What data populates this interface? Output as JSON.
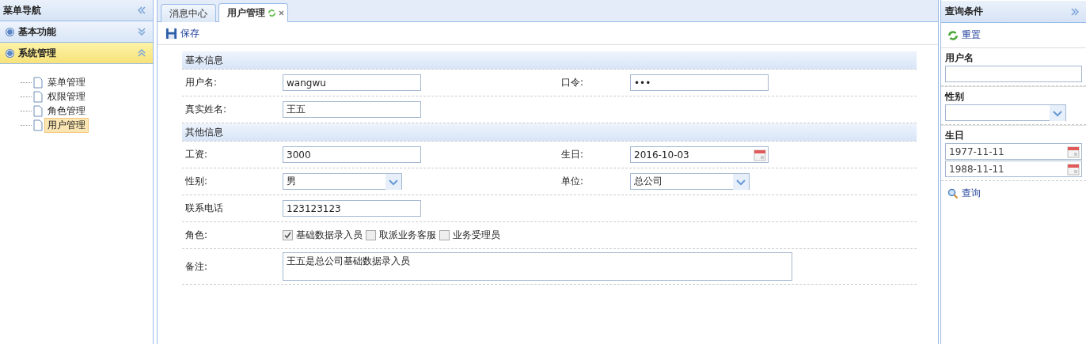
{
  "sidebar": {
    "title": "菜单导航",
    "groups": [
      {
        "label": "基本功能",
        "expanded": false
      },
      {
        "label": "系统管理",
        "expanded": true,
        "items": [
          {
            "label": "菜单管理",
            "selected": false
          },
          {
            "label": "权限管理",
            "selected": false
          },
          {
            "label": "角色管理",
            "selected": false
          },
          {
            "label": "用户管理",
            "selected": true
          }
        ]
      }
    ]
  },
  "tabs": [
    {
      "label": "消息中心",
      "selected": false,
      "closable": false
    },
    {
      "label": "用户管理",
      "selected": true,
      "closable": true
    }
  ],
  "toolbar": {
    "save": "保存"
  },
  "form": {
    "sections": [
      {
        "title": "基本信息",
        "rows": [
          [
            {
              "label": "用户名:",
              "kind": "text",
              "value": "wangwu"
            },
            {
              "label": "口令:",
              "kind": "password",
              "value": "•••"
            }
          ],
          [
            {
              "label": "真实姓名:",
              "kind": "text",
              "value": "王五"
            }
          ]
        ]
      },
      {
        "title": "其他信息",
        "rows": [
          [
            {
              "label": "工资:",
              "kind": "text",
              "value": "3000"
            },
            {
              "label": "生日:",
              "kind": "date",
              "value": "2016-10-03"
            }
          ],
          [
            {
              "label": "性别:",
              "kind": "select",
              "value": "男"
            },
            {
              "label": "单位:",
              "kind": "select",
              "value": "总公司"
            }
          ],
          [
            {
              "label": "联系电话",
              "kind": "text",
              "value": "123123123"
            }
          ],
          [
            {
              "label": "角色:",
              "kind": "checkboxes",
              "options": [
                {
                  "label": "基础数据录入员",
                  "checked": true
                },
                {
                  "label": "取派业务客服",
                  "checked": false
                },
                {
                  "label": "业务受理员",
                  "checked": false
                }
              ]
            }
          ],
          [
            {
              "label": "备注:",
              "kind": "textarea",
              "value": "王五是总公司基础数据录入员"
            }
          ]
        ]
      }
    ]
  },
  "query": {
    "title": "查询条件",
    "reset": "重置",
    "fields": [
      {
        "label": "用户名",
        "kind": "text"
      },
      {
        "label": "性别",
        "kind": "select"
      },
      {
        "label": "生日",
        "kind": "daterange",
        "values": [
          "1977-11-11",
          "1988-11-11"
        ]
      }
    ],
    "search": "查询"
  }
}
